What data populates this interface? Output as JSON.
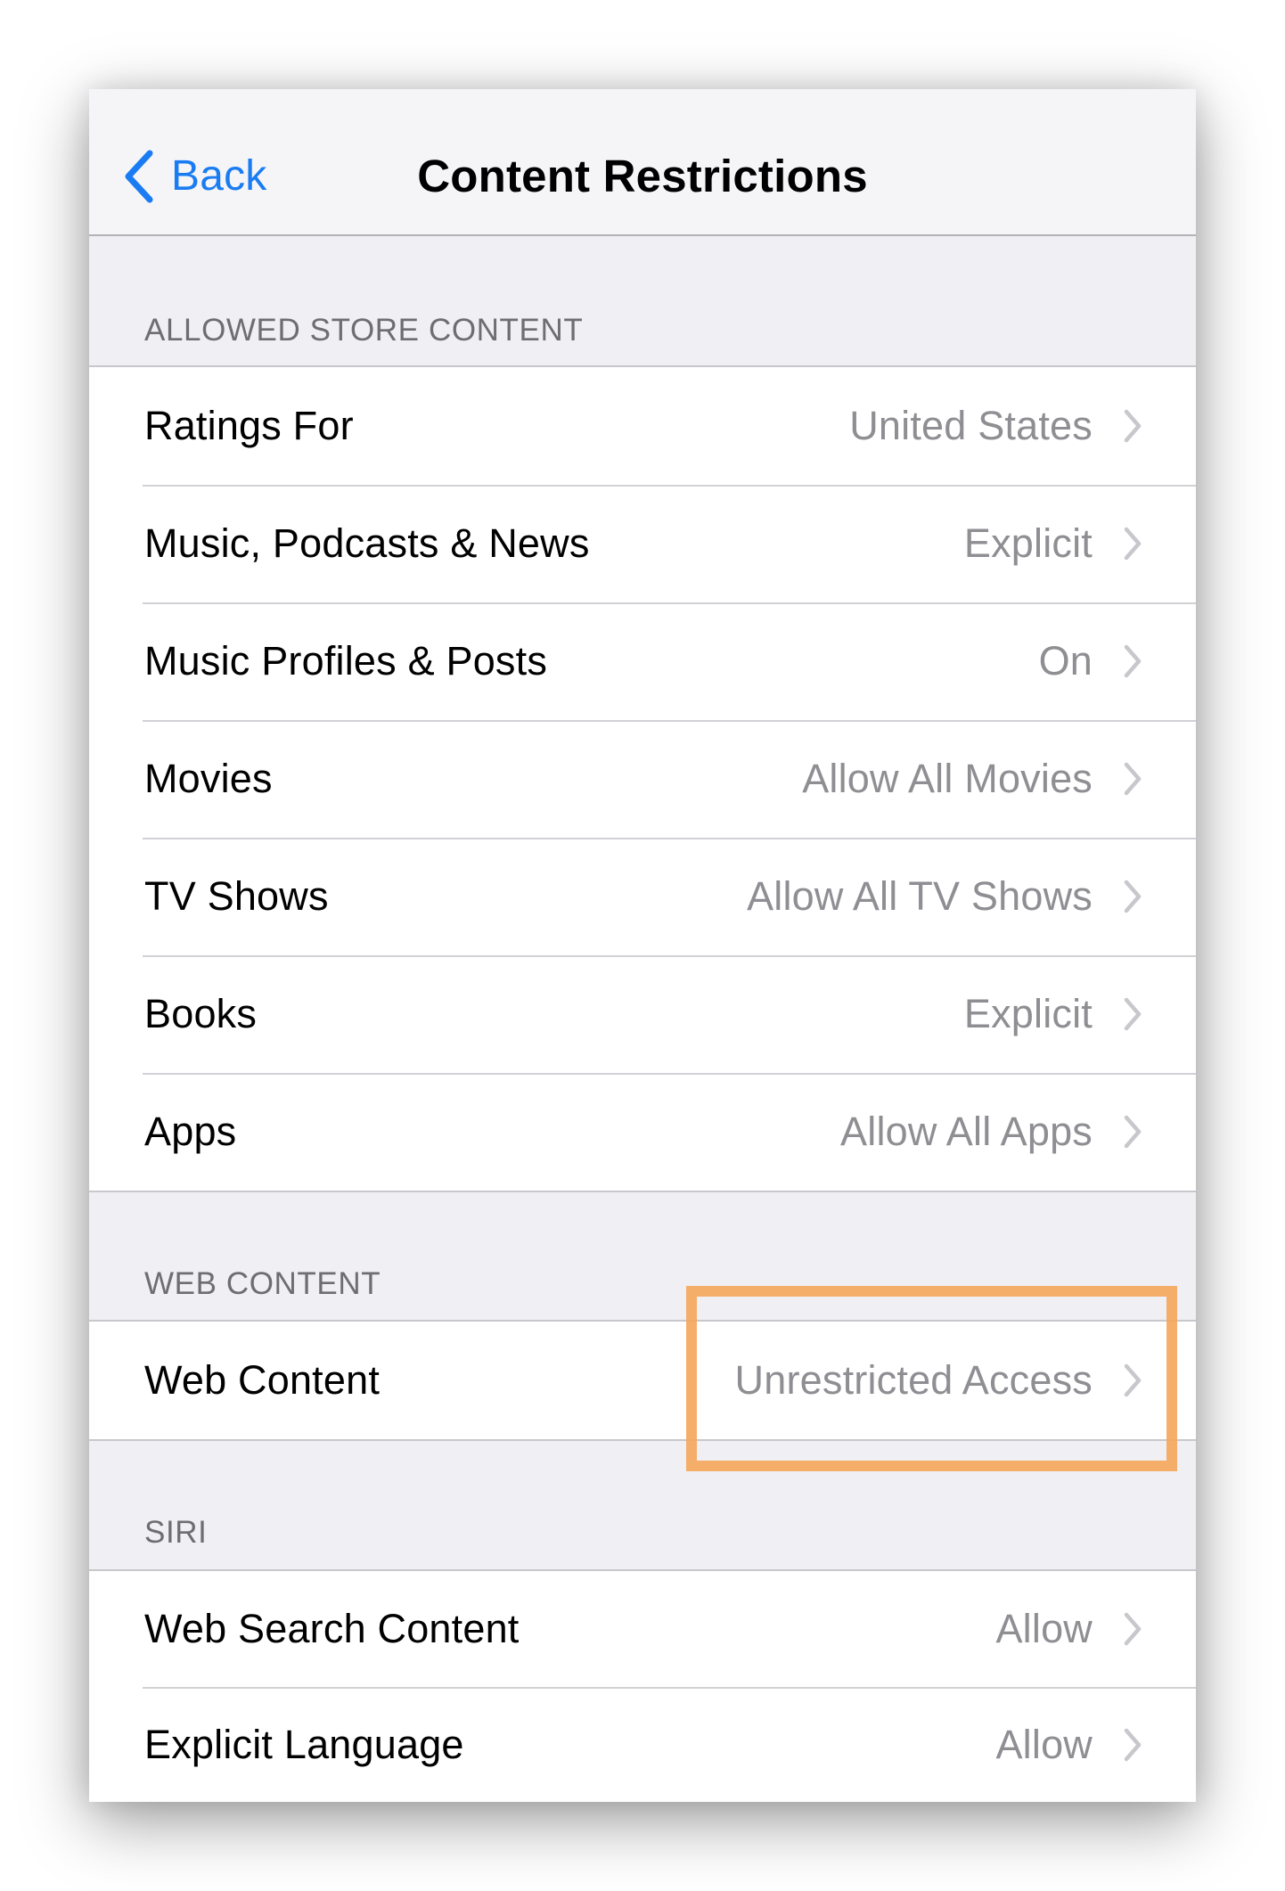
{
  "nav": {
    "back_label": "Back",
    "title": "Content Restrictions"
  },
  "sections": [
    {
      "header": "ALLOWED STORE CONTENT",
      "rows": [
        {
          "label": "Ratings For",
          "value": "United States"
        },
        {
          "label": "Music, Podcasts & News",
          "value": "Explicit"
        },
        {
          "label": "Music Profiles & Posts",
          "value": "On"
        },
        {
          "label": "Movies",
          "value": "Allow All Movies"
        },
        {
          "label": "TV Shows",
          "value": "Allow All TV Shows"
        },
        {
          "label": "Books",
          "value": "Explicit"
        },
        {
          "label": "Apps",
          "value": "Allow All Apps"
        }
      ]
    },
    {
      "header": "WEB CONTENT",
      "rows": [
        {
          "label": "Web Content",
          "value": "Unrestricted Access"
        }
      ]
    },
    {
      "header": "SIRI",
      "rows": [
        {
          "label": "Web Search Content",
          "value": "Allow"
        },
        {
          "label": "Explicit Language",
          "value": "Allow"
        }
      ]
    }
  ],
  "icons": {
    "back": "chevron-left-icon",
    "disclosure": "chevron-right-icon"
  },
  "colors": {
    "accent": "#1A7CF2",
    "highlight": "#F5A65A",
    "value_text": "#8E8E93",
    "section_header": "#6D6D72",
    "grouped_background": "#EFEFF4"
  },
  "annotation": {
    "highlighted_row": "Web Content"
  }
}
